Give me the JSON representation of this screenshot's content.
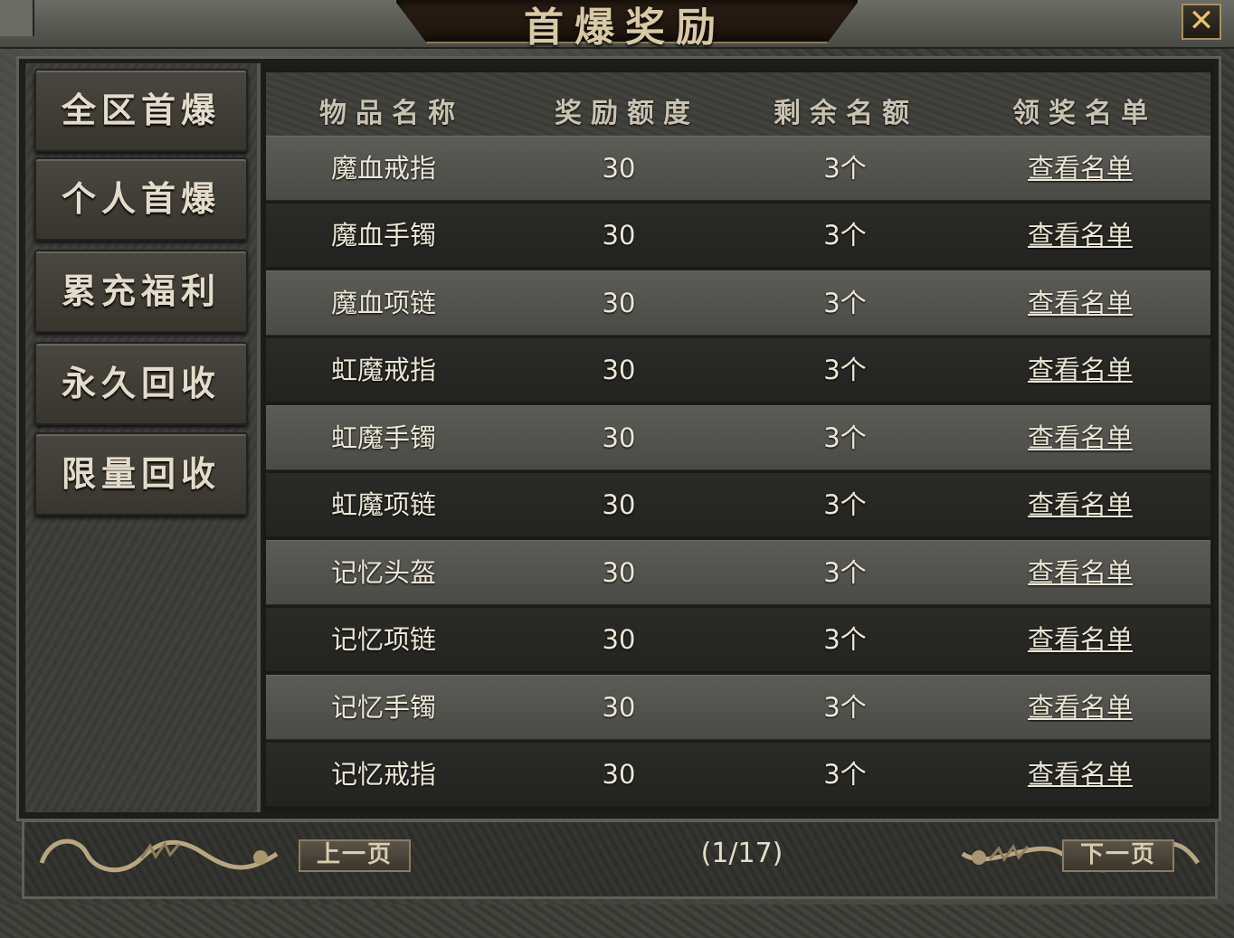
{
  "window": {
    "title": "首爆奖励",
    "close_label": "✕"
  },
  "sidebar": {
    "items": [
      {
        "label": "全区首爆"
      },
      {
        "label": "个人首爆"
      },
      {
        "label": "累充福利"
      },
      {
        "label": "永久回收"
      },
      {
        "label": "限量回收"
      }
    ]
  },
  "table": {
    "headers": [
      "物品名称",
      "奖励额度",
      "剩余名额",
      "领奖名单"
    ],
    "rows": [
      {
        "item": "魔血戒指",
        "reward": "30",
        "remaining": "3个",
        "action": "查看名单"
      },
      {
        "item": "魔血手镯",
        "reward": "30",
        "remaining": "3个",
        "action": "查看名单"
      },
      {
        "item": "魔血项链",
        "reward": "30",
        "remaining": "3个",
        "action": "查看名单"
      },
      {
        "item": "虹魔戒指",
        "reward": "30",
        "remaining": "3个",
        "action": "查看名单"
      },
      {
        "item": "虹魔手镯",
        "reward": "30",
        "remaining": "3个",
        "action": "查看名单"
      },
      {
        "item": "虹魔项链",
        "reward": "30",
        "remaining": "3个",
        "action": "查看名单"
      },
      {
        "item": "记忆头盔",
        "reward": "30",
        "remaining": "3个",
        "action": "查看名单"
      },
      {
        "item": "记忆项链",
        "reward": "30",
        "remaining": "3个",
        "action": "查看名单"
      },
      {
        "item": "记忆手镯",
        "reward": "30",
        "remaining": "3个",
        "action": "查看名单"
      },
      {
        "item": "记忆戒指",
        "reward": "30",
        "remaining": "3个",
        "action": "查看名单"
      }
    ]
  },
  "pagination": {
    "prev_label": "上一页",
    "next_label": "下一页",
    "indicator": "(1/17)"
  },
  "colors": {
    "text": "#ece6d6",
    "accent_gold": "#e6c46a"
  }
}
